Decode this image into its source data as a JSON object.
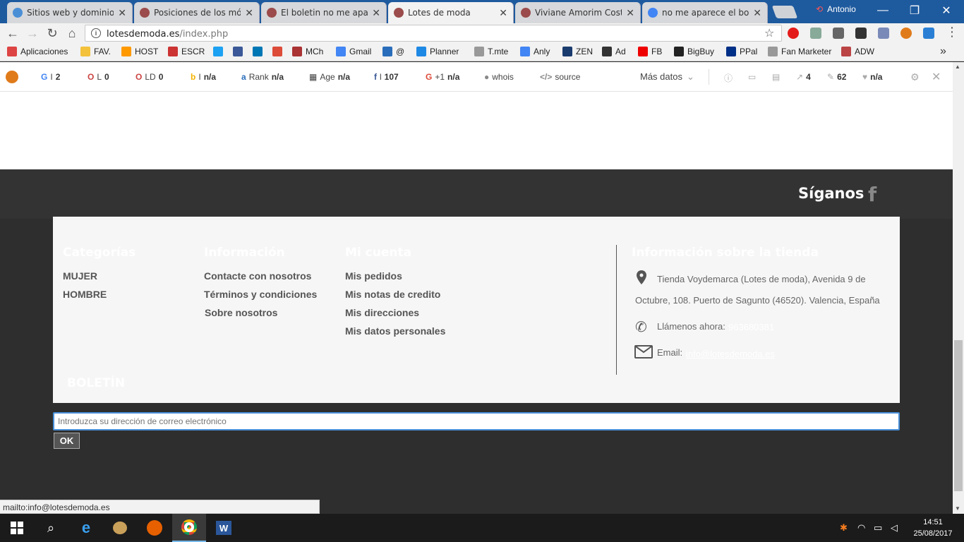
{
  "window": {
    "tabs": [
      {
        "label": "Sitios web y dominios",
        "icon_color": "#4a8fd6"
      },
      {
        "label": "Posiciones de los mód",
        "icon_color": "#9b4b4b"
      },
      {
        "label": "El boletin no me apare",
        "icon_color": "#9b4b4b"
      },
      {
        "label": "Lotes de moda",
        "icon_color": "#9b4b4b"
      },
      {
        "label": "Viviane Amorim Costa",
        "icon_color": "#9b4b4b"
      },
      {
        "label": "no me aparece el bole",
        "icon_color": "#4285f4"
      }
    ],
    "tab_close": "✕",
    "user_name": "Antonio",
    "minimize": "—",
    "maximize": "❐",
    "close": "✕"
  },
  "toolbar": {
    "url_host": "lotesdemoda.es",
    "url_path": "/index.php",
    "info_glyph": "i"
  },
  "bookmarks": [
    {
      "label": "Aplicaciones",
      "color": "#d44"
    },
    {
      "label": "FAV.",
      "color": "#f3c13a"
    },
    {
      "label": "HOST",
      "color": "#f90"
    },
    {
      "label": "ESCR",
      "color": "#c33"
    },
    {
      "label": "",
      "color": "#1da1f2"
    },
    {
      "label": "",
      "color": "#3b5998"
    },
    {
      "label": "",
      "color": "#0077b5"
    },
    {
      "label": "",
      "color": "#dd4b39"
    },
    {
      "label": "MCh",
      "color": "#a33"
    },
    {
      "label": "Gmail",
      "color": "#4285f4"
    },
    {
      "label": "@",
      "color": "#2a6ebb"
    },
    {
      "label": "Planner",
      "color": "#1e88e5"
    },
    {
      "label": "T.mte",
      "color": "#999"
    },
    {
      "label": "Anly",
      "color": "#4285f4"
    },
    {
      "label": "ZEN",
      "color": "#1a3b6e"
    },
    {
      "label": "Ad",
      "color": "#333"
    },
    {
      "label": "FB",
      "color": "#e00"
    },
    {
      "label": "BigBuy",
      "color": "#222"
    },
    {
      "label": "PPal",
      "color": "#003087"
    },
    {
      "label": "Fan Marketer",
      "color": "#999"
    },
    {
      "label": "ADW",
      "color": "#b44"
    }
  ],
  "bookmarks_more": "»",
  "seoquake": [
    {
      "icon": "G",
      "icon_color": "#4285f4",
      "label": "I",
      "value": "2"
    },
    {
      "icon": "O",
      "icon_color": "#c44",
      "label": "L",
      "value": "0"
    },
    {
      "icon": "O",
      "icon_color": "#c44",
      "label": "LD",
      "value": "0"
    },
    {
      "icon": "b",
      "icon_color": "#f3b300",
      "label": "I",
      "value": "n/a"
    },
    {
      "icon": "a",
      "icon_color": "#2a6ebb",
      "label": "Rank",
      "value": "n/a"
    },
    {
      "icon": "▦",
      "icon_color": "#444",
      "label": "Age",
      "value": "n/a"
    },
    {
      "icon": "f",
      "icon_color": "#3b5998",
      "label": "l",
      "value": "107"
    },
    {
      "icon": "G",
      "icon_color": "#dd4b39",
      "label": "+1",
      "value": "n/a"
    },
    {
      "icon": "●",
      "icon_color": "#888",
      "label": "whois",
      "value": ""
    },
    {
      "icon": "</>",
      "icon_color": "#888",
      "label": "source",
      "value": ""
    }
  ],
  "seoquake_more": "Más datos",
  "seoquake_right": [
    {
      "icon": "ⓘ",
      "value": ""
    },
    {
      "icon": "▭",
      "value": ""
    },
    {
      "icon": "▤",
      "value": ""
    },
    {
      "icon": "↗",
      "value": "4"
    },
    {
      "icon": "✎",
      "value": "62"
    },
    {
      "icon": "♥",
      "value": "n/a"
    }
  ],
  "page": {
    "follow_title": "Síganos",
    "facebook_glyph": "f",
    "columns": [
      {
        "title": "Categorías",
        "links": [
          "MUJER",
          "HOMBRE"
        ]
      },
      {
        "title": "Información",
        "links": [
          "Contacte con nosotros",
          "Términos y condiciones",
          "Sobre nosotros"
        ]
      },
      {
        "title": "Mi cuenta",
        "links": [
          "Mis pedidos",
          "Mis notas de credito",
          "Mis direcciones",
          "Mis datos personales"
        ]
      }
    ],
    "store_info": {
      "title": "Información sobre la tienda",
      "address": "Tienda Voydemarca (Lotes de moda), Avenida 9 de Octubre, 108. Puerto de Sagunto (46520). Valencia, España",
      "phone_label": "Llámenos ahora:",
      "phone": "963680381",
      "email_label": "Email:",
      "email": "info@lotesdemoda.es"
    },
    "newsletter": {
      "title": "BOLETÍN",
      "placeholder": "Introduzca su dirección de correo electrónico",
      "button": "OK"
    }
  },
  "status_bar": "mailto:info@lotesdemoda.es",
  "taskbar": {
    "time": "14:51",
    "date": "25/08/2017"
  }
}
